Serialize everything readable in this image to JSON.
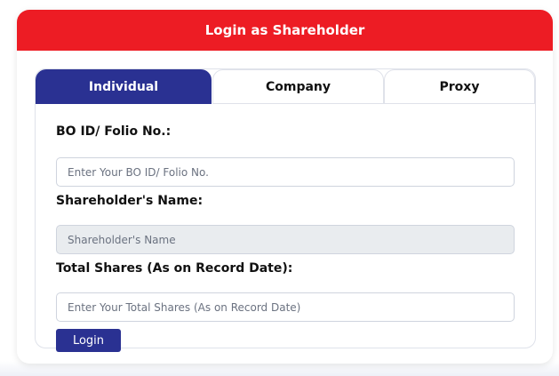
{
  "header": {
    "title": "Login as Shareholder"
  },
  "tabs": [
    {
      "label": "Individual",
      "active": true
    },
    {
      "label": "Company",
      "active": false
    },
    {
      "label": "Proxy",
      "active": false
    }
  ],
  "form": {
    "bo_id": {
      "label": "BO ID/ Folio No.:",
      "placeholder": "Enter Your BO ID/ Folio No.",
      "value": ""
    },
    "name": {
      "label": "Shareholder's Name:",
      "placeholder": "Shareholder's Name",
      "value": ""
    },
    "shares": {
      "label": "Total Shares (As on Record Date):",
      "placeholder": "Enter Your Total Shares (As on Record Date)",
      "value": ""
    },
    "login_label": "Login"
  },
  "colors": {
    "header": "#ed1c24",
    "accent": "#2a3192"
  }
}
